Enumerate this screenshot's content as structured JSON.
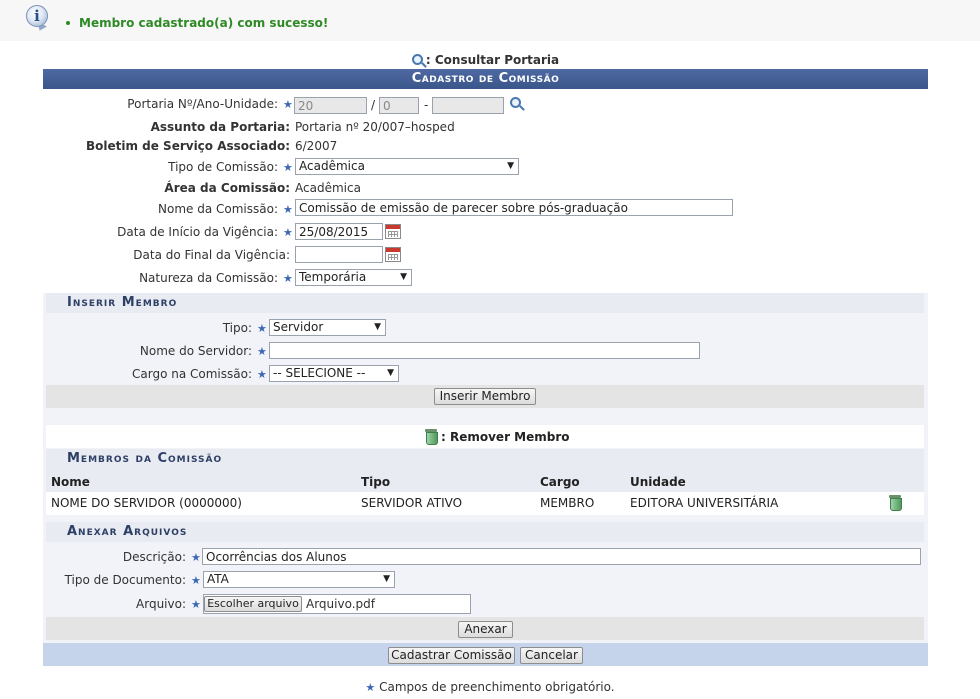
{
  "message": {
    "text": "Membro cadastrado(a) com sucesso!",
    "icon": "info-icon",
    "color": "#2f8a26"
  },
  "consult_link": ": Consultar Portaria",
  "title": "Cadastro de Comissão",
  "form": {
    "portaria_label": "Portaria Nº/Ano-Unidade:",
    "portaria_num": "20",
    "portaria_ano": "0",
    "portaria_unidade": "",
    "sep_slash": "/",
    "sep_dash": "-",
    "assunto_label": "Assunto da Portaria:",
    "assunto_value": "Portaria nº 20/007–hosped",
    "boletim_label": "Boletim de Serviço Associado:",
    "boletim_value": "6/2007",
    "tipo_label": "Tipo de Comissão:",
    "tipo_value": "Acadêmica",
    "area_label": "Área da Comissão:",
    "area_value": "Acadêmica",
    "nome_label": "Nome da Comissão:",
    "nome_value": "Comissão de emissão de parecer sobre pós-graduação",
    "inicio_label": "Data de Início da Vigência:",
    "inicio_value": "25/08/2015",
    "final_label": "Data do Final da Vigência:",
    "final_value": "",
    "natureza_label": "Natureza da Comissão:",
    "natureza_value": "Temporária"
  },
  "inserir": {
    "title": "Inserir Membro",
    "tipo_label": "Tipo:",
    "tipo_value": "Servidor",
    "servidor_label": "Nome do Servidor:",
    "servidor_value": "",
    "cargo_label": "Cargo na Comissão:",
    "cargo_value": "-- SELECIONE --",
    "button": "Inserir Membro"
  },
  "remover_legend": ": Remover Membro",
  "membros": {
    "title": "Membros da Comissão",
    "headers": [
      "Nome",
      "Tipo",
      "Cargo",
      "Unidade"
    ],
    "rows": [
      {
        "nome": "NOME DO SERVIDOR (0000000)",
        "tipo": "SERVIDOR ATIVO",
        "cargo": "MEMBRO",
        "unidade": "EDITORA UNIVERSITÁRIA"
      }
    ]
  },
  "anexar": {
    "title": "Anexar Arquivos",
    "descricao_label": "Descrição:",
    "descricao_value": "Ocorrências dos Alunos",
    "tipodoc_label": "Tipo de Documento:",
    "tipodoc_value": "ATA",
    "arquivo_label": "Arquivo:",
    "arquivo_button": "Escolher arquivo",
    "arquivo_value": "Arquivo.pdf",
    "button": "Anexar"
  },
  "actions": {
    "cadastrar": "Cadastrar Comissão",
    "cancelar": "Cancelar"
  },
  "footer": {
    "star": "★",
    "text": " Campos de preenchimento obrigatório."
  }
}
